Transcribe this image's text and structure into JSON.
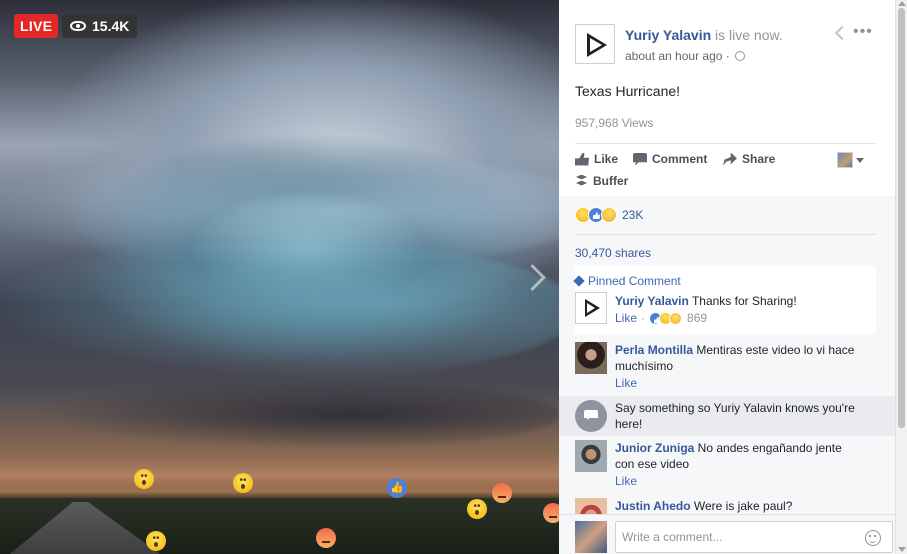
{
  "video": {
    "live_label": "LIVE",
    "viewer_count": "15.4K"
  },
  "post": {
    "page_name": "Yuriy Yalavin",
    "status": " is live now.",
    "time": "about an hour ago",
    "title": "Texas Hurricane!",
    "views": "957,968 Views"
  },
  "actions": {
    "like": "Like",
    "comment": "Comment",
    "share": "Share",
    "buffer": "Buffer"
  },
  "reactions": {
    "count": "23K",
    "shares": "30,470 shares"
  },
  "pinned": {
    "label": "Pinned Comment",
    "author": "Yuriy Yalavin",
    "text": " Thanks for Sharing!",
    "like_label": "Like",
    "reaction_count": "869"
  },
  "comments": [
    {
      "author": "Perla Montilla",
      "text": " Mentiras este video lo vi hace muchísimo",
      "like_label": "Like"
    },
    {
      "author": "Junior Zuniga",
      "text": " No andes engañando jente con ese video",
      "like_label": "Like"
    },
    {
      "author": "Justin Ahedo",
      "text": " Were is jake paul?"
    }
  ],
  "prompt": {
    "text": "Say something so Yuriy Yalavin knows you're here!"
  },
  "composer": {
    "placeholder": "Write a comment..."
  },
  "colors": {
    "live_red": "#e42828",
    "link_blue": "#365899",
    "pinned_blue": "#4267b2"
  }
}
